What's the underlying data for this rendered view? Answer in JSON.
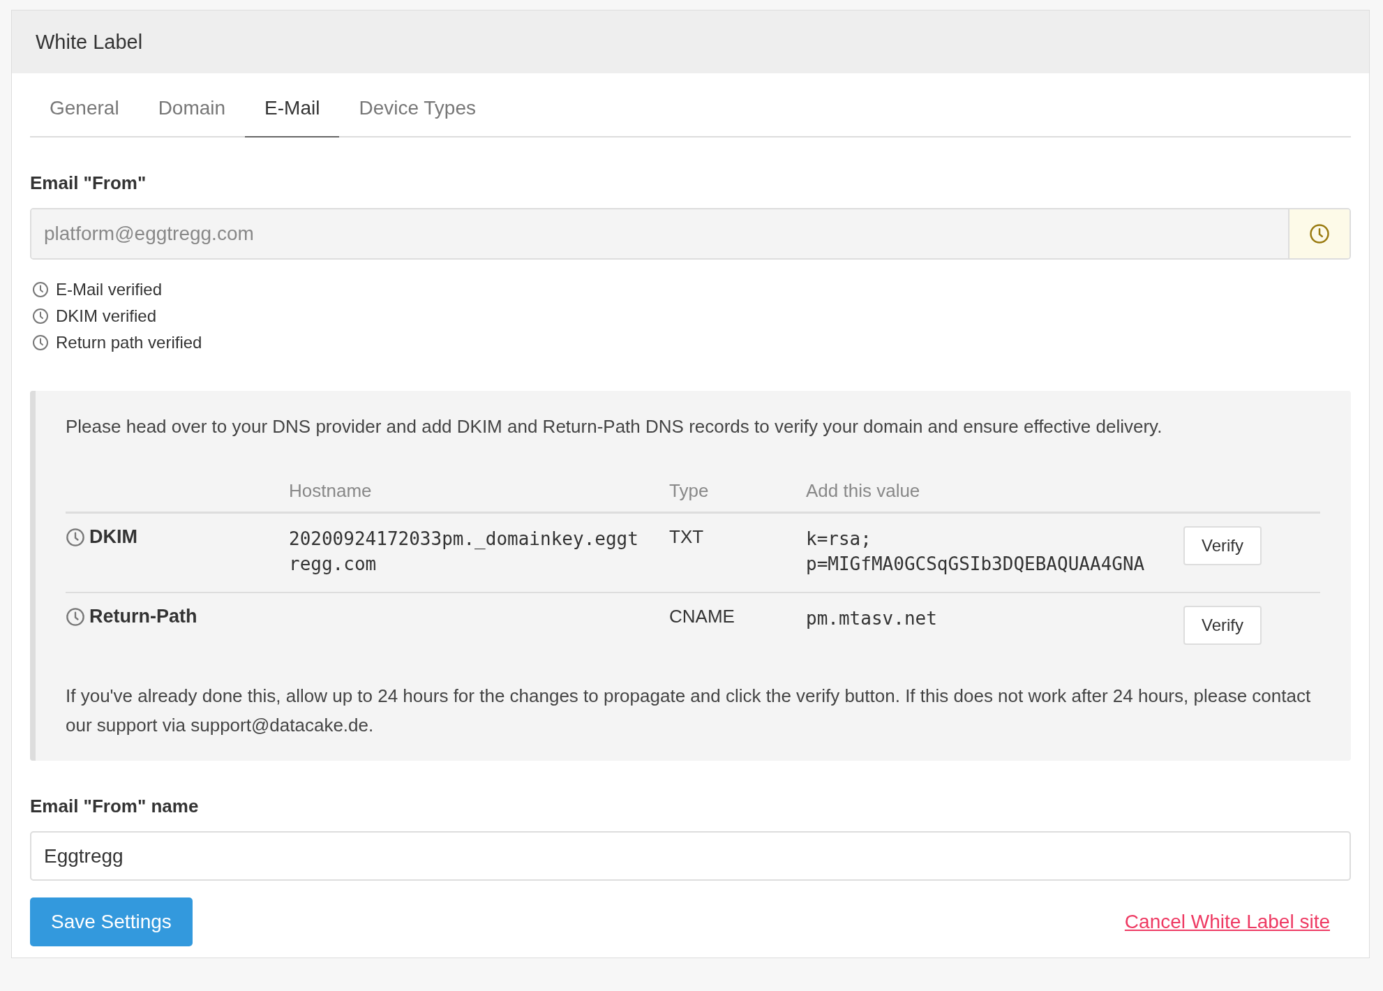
{
  "panel": {
    "title": "White Label"
  },
  "tabs": [
    {
      "label": "General",
      "selected": false
    },
    {
      "label": "Domain",
      "selected": false
    },
    {
      "label": "E-Mail",
      "selected": true
    },
    {
      "label": "Device Types",
      "selected": false
    }
  ],
  "email_from": {
    "label": "Email \"From\"",
    "value": "platform@eggtregg.com",
    "disabled": true
  },
  "checks": [
    "E-Mail verified",
    "DKIM verified",
    "Return path verified"
  ],
  "dns_box": {
    "intro": "Please head over to your DNS provider and add DKIM and Return-Path DNS records to verify your domain and ensure effective delivery.",
    "columns": [
      "Hostname",
      "Type",
      "Add this value"
    ],
    "rows": [
      {
        "name": "DKIM",
        "hostname": "20200924172033pm._domainkey.eggtregg.com",
        "type": "TXT",
        "value": "k=rsa; p=MIGfMA0GCSqGSIb3DQEBAQUAA4GNA",
        "button": "Verify"
      },
      {
        "name": "Return-Path",
        "type": "CNAME",
        "value": "pm.mtasv.net",
        "button": "Verify"
      }
    ],
    "note": "If you've already done this, allow up to 24 hours for the changes to propagate and click the verify button. If this does not work after 24 hours, please contact our support via support@datacake.de."
  },
  "email_from_name": {
    "label": "Email \"From\" name",
    "value": "Eggtregg"
  },
  "save_button": "Save Settings",
  "cancel_link": "Cancel White Label site"
}
